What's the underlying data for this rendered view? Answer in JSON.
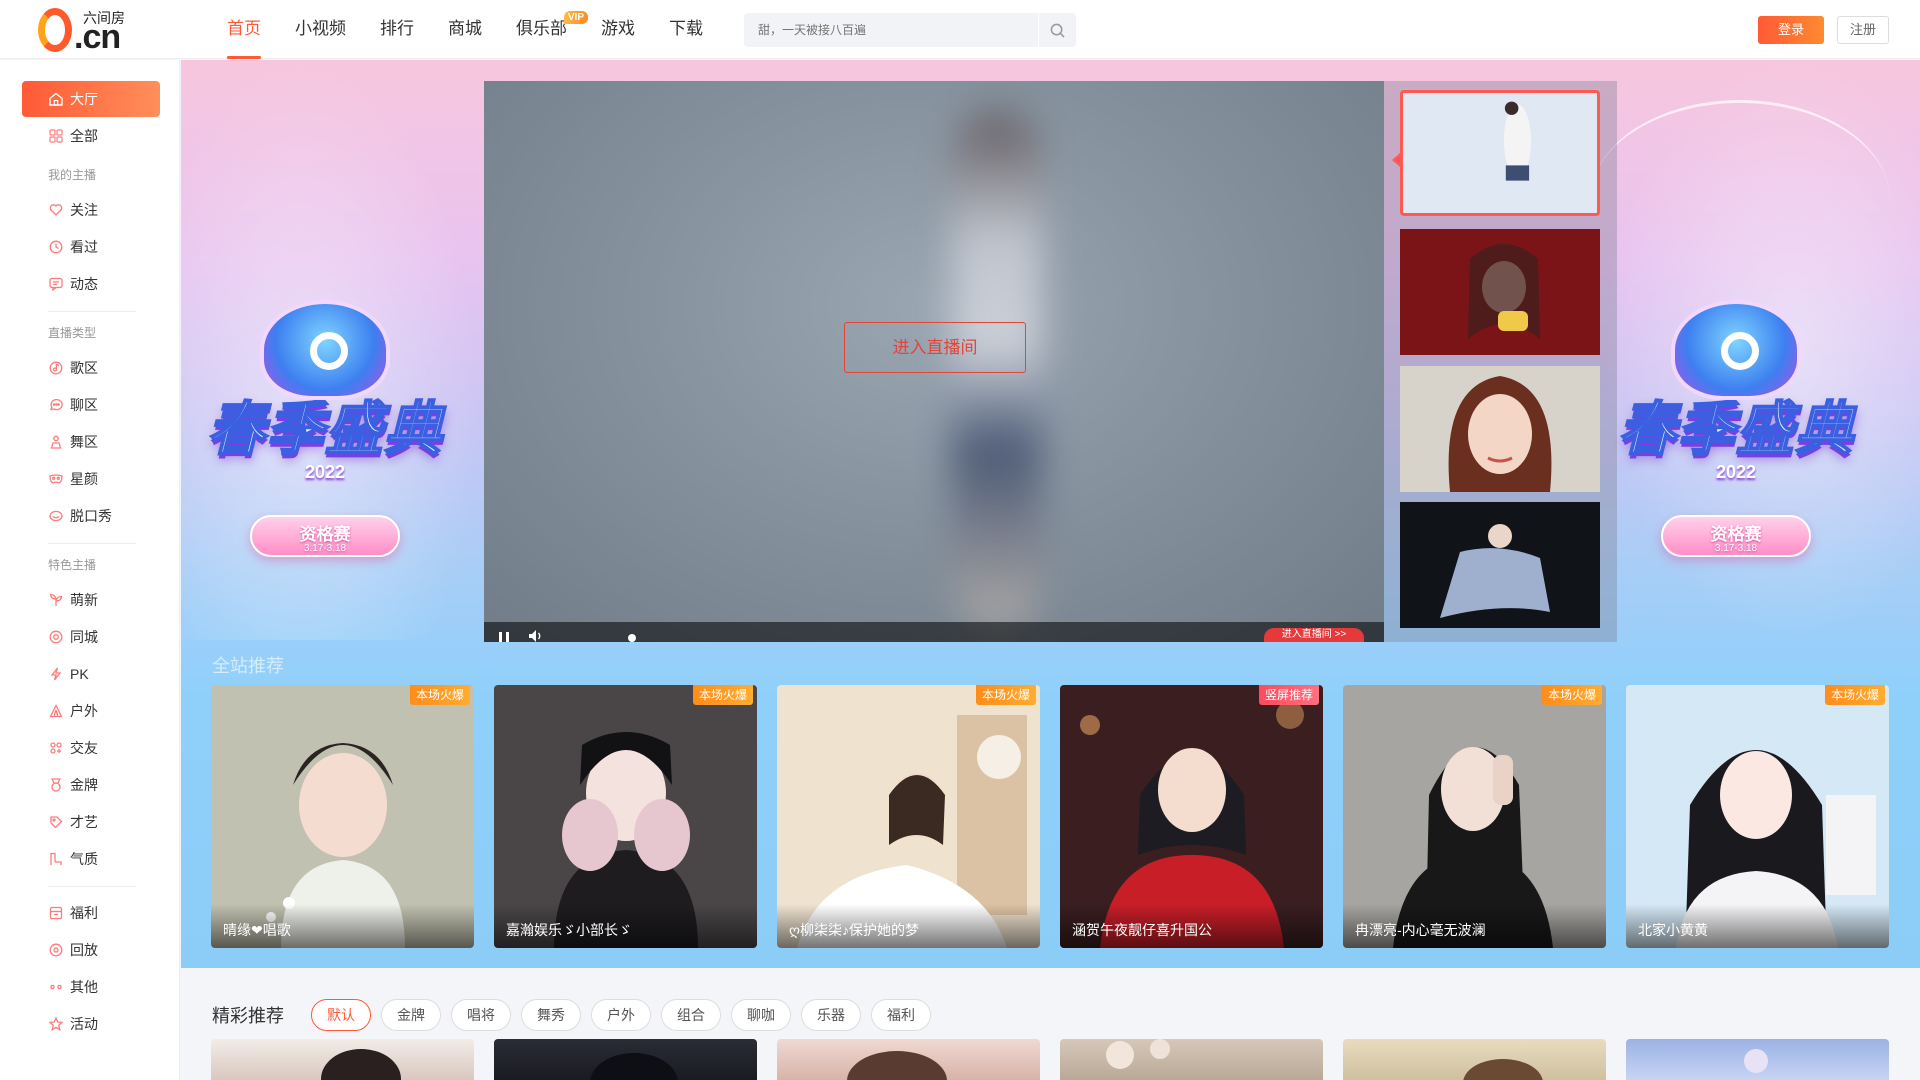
{
  "brand": {
    "logo_cn": ".cn",
    "logo_name": "六间房",
    "logo_digit": "6"
  },
  "nav": [
    {
      "label": "首页",
      "active": true
    },
    {
      "label": "小视频"
    },
    {
      "label": "排行"
    },
    {
      "label": "商城"
    },
    {
      "label": "俱乐部",
      "badge": "VIP"
    },
    {
      "label": "游戏"
    },
    {
      "label": "下载"
    }
  ],
  "search": {
    "placeholder": "甜，一天被接八百遍"
  },
  "auth": {
    "login": "登录",
    "register": "注册"
  },
  "sidebar": {
    "items": [
      {
        "label": "大厅",
        "icon": "home-icon",
        "active": true
      },
      {
        "label": "全部",
        "icon": "grid-icon"
      }
    ],
    "group_my": "我的主播",
    "my_items": [
      {
        "label": "关注",
        "icon": "heart-icon"
      },
      {
        "label": "看过",
        "icon": "clock-icon"
      },
      {
        "label": "动态",
        "icon": "message-icon"
      }
    ],
    "group_type": "直播类型",
    "type_items": [
      {
        "label": "歌区",
        "icon": "music-icon"
      },
      {
        "label": "聊区",
        "icon": "chat-icon"
      },
      {
        "label": "舞区",
        "icon": "dance-icon"
      },
      {
        "label": "星颜",
        "icon": "mask-icon"
      },
      {
        "label": "脱口秀",
        "icon": "mic-icon"
      }
    ],
    "group_special": "特色主播",
    "special_items": [
      {
        "label": "萌新",
        "icon": "sprout-icon"
      },
      {
        "label": "同城",
        "icon": "location-icon"
      },
      {
        "label": "PK",
        "icon": "lightning-icon"
      },
      {
        "label": "户外",
        "icon": "tent-icon"
      },
      {
        "label": "交友",
        "icon": "friends-icon"
      },
      {
        "label": "金牌",
        "icon": "medal-icon"
      },
      {
        "label": "才艺",
        "icon": "palette-icon"
      },
      {
        "label": "气质",
        "icon": "flag-icon"
      }
    ],
    "other_items": [
      {
        "label": "福利",
        "icon": "gift-icon"
      },
      {
        "label": "回放",
        "icon": "replay-icon"
      },
      {
        "label": "其他",
        "icon": "more-icon"
      },
      {
        "label": "活动",
        "icon": "star-icon"
      }
    ]
  },
  "banner": {
    "event_title": "春季盛典",
    "event_year": "2022",
    "event_stage": "资格赛",
    "event_dates": "3.17-3.18"
  },
  "player": {
    "enter_label": "进入直播间",
    "enter_mini_label": "进入直播间 >>"
  },
  "featured": {
    "title": "全站推荐",
    "cards": [
      {
        "tag": "本场火爆",
        "name": "晴缘❤唱歌",
        "palette": [
          "#d9d3c8",
          "#7c8a6a",
          "#eef0ea"
        ]
      },
      {
        "tag": "本场火爆",
        "name": "嘉瀚娱乐ゞ小部长ゞ",
        "palette": [
          "#4a4648",
          "#1e1c1f",
          "#e7c7cf"
        ]
      },
      {
        "tag": "本场火爆",
        "name": "ღ柳柒柒♪保护她的梦",
        "palette": [
          "#efe2cf",
          "#ffffff",
          "#c9a27a"
        ]
      },
      {
        "tag": "竖屏推荐",
        "name": "涵贺午夜靓仔喜升国公",
        "palette": [
          "#3a1e20",
          "#c81e28",
          "#1c1c22"
        ]
      },
      {
        "tag": "本场火爆",
        "name": "冉漂亮-内心毫无波澜",
        "palette": [
          "#8e8c8b",
          "#181818",
          "#d7d3cf"
        ]
      },
      {
        "tag": "本场火爆",
        "name": "北家小黄黄",
        "palette": [
          "#d4e8f6",
          "#1a1a1e",
          "#f4f4f6"
        ]
      }
    ]
  },
  "recommend": {
    "title": "精彩推荐",
    "tabs": [
      "默认",
      "金牌",
      "唱将",
      "舞秀",
      "户外",
      "组合",
      "聊咖",
      "乐器",
      "福利"
    ],
    "active_tab": "默认"
  },
  "colors": {
    "accent": "#ff5a36",
    "tag_hot": "#ff9a22",
    "tag_vertical": "#ff4a5c"
  }
}
